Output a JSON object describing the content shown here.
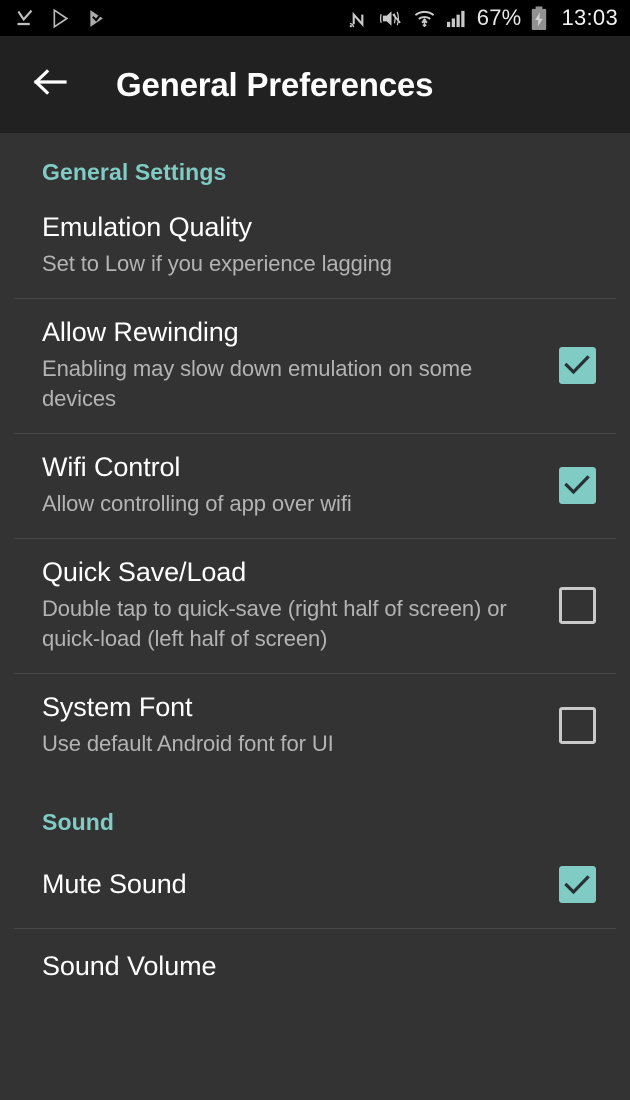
{
  "statusbar": {
    "left_icons": [
      "download-complete-icon",
      "play-store-icon",
      "play-store-check-icon"
    ],
    "right_icons": [
      "nfc-icon",
      "volume-mute-icon",
      "wifi-icon",
      "cellular-signal-icon"
    ],
    "battery_percent": "67%",
    "battery_icon": "battery-charging-icon",
    "time": "13:03"
  },
  "toolbar": {
    "back_icon": "back-arrow-icon",
    "title": "General Preferences"
  },
  "colors": {
    "accent": "#80cbc4",
    "statusbar_bg": "#000000",
    "toolbar_bg": "#212121",
    "content_bg": "#333333",
    "title_text": "#ffffff",
    "summary_text": "#b3b3b3",
    "divider": "#464646",
    "checkbox_unchecked_border": "#c9c9c9",
    "checkmark": "#263238"
  },
  "sections": [
    {
      "header": "General Settings",
      "items": [
        {
          "title": "Emulation Quality",
          "summary": "Set to Low if you experience lagging",
          "widget": "none",
          "checked": null
        },
        {
          "title": "Allow Rewinding",
          "summary": "Enabling may slow down emulation on some devices",
          "widget": "checkbox",
          "checked": true
        },
        {
          "title": "Wifi Control",
          "summary": "Allow controlling of app over wifi",
          "widget": "checkbox",
          "checked": true
        },
        {
          "title": "Quick Save/Load",
          "summary": "Double tap to quick-save (right half of screen) or quick-load (left half of screen)",
          "widget": "checkbox",
          "checked": false
        },
        {
          "title": "System Font",
          "summary": "Use default Android font for UI",
          "widget": "checkbox",
          "checked": false
        }
      ]
    },
    {
      "header": "Sound",
      "items": [
        {
          "title": "Mute Sound",
          "summary": "",
          "widget": "checkbox",
          "checked": true
        },
        {
          "title": "Sound Volume",
          "summary": "",
          "widget": "none",
          "checked": null
        }
      ]
    }
  ]
}
